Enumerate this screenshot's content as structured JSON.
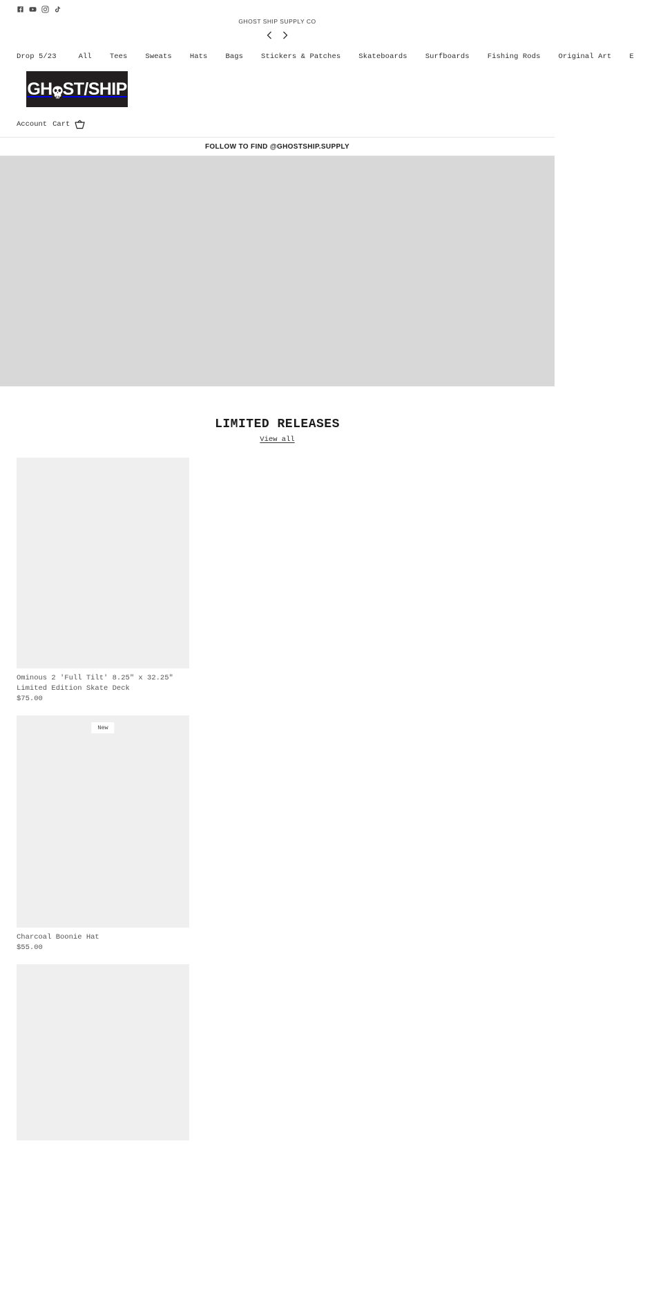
{
  "topbar": {
    "socials": [
      {
        "name": "facebook-icon",
        "label": "Facebook"
      },
      {
        "name": "youtube-icon",
        "label": "YouTube"
      },
      {
        "name": "instagram-icon",
        "label": "Instagram"
      },
      {
        "name": "tiktok-icon",
        "label": "TikTok"
      }
    ]
  },
  "announcement": {
    "text": "GHOST SHIP SUPPLY CO",
    "prev_label": "Previous",
    "next_label": "Next"
  },
  "nav": {
    "items": [
      {
        "label": "Drop 5/23"
      },
      {
        "label": "All"
      },
      {
        "label": "Tees"
      },
      {
        "label": "Sweats"
      },
      {
        "label": "Hats"
      },
      {
        "label": "Bags"
      },
      {
        "label": "Stickers & Patches"
      },
      {
        "label": "Skateboards"
      },
      {
        "label": "Surfboards"
      },
      {
        "label": "Fishing Rods"
      },
      {
        "label": "Original Art"
      },
      {
        "label": "E"
      }
    ]
  },
  "logo": {
    "text_before": "GH",
    "text_after": "ST/SHIP",
    "icon": "skull-icon",
    "background": "#231f20",
    "color": "#ffffff"
  },
  "account_bar": {
    "account_label": "Account",
    "cart_label": "Cart",
    "cart_icon": "basket-icon"
  },
  "follow_banner": {
    "text": "FOLLOW TO FIND @GHOSTSHIP.SUPPLY"
  },
  "hero": {
    "placeholder_color": "#d8d8d8"
  },
  "collection": {
    "title": "LIMITED RELEASES",
    "view_all_label": "View all",
    "products": [
      {
        "title": "Ominous 2 'Full Tilt' 8.25\" x 32.25\" Limited Edition Skate Deck",
        "price": "$75.00",
        "badge": null
      },
      {
        "title": "Charcoal Boonie Hat",
        "price": "$55.00",
        "badge": "New"
      },
      {
        "title": "",
        "price": "",
        "badge": null
      }
    ]
  }
}
